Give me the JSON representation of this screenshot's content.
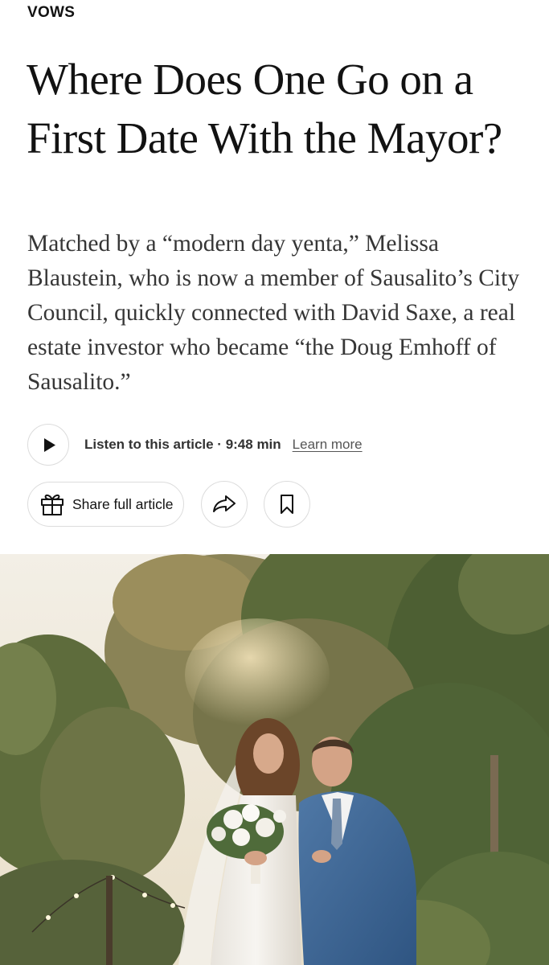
{
  "article": {
    "kicker": "VOWS",
    "headline": "Where Does One Go on a First Date With the Mayor?",
    "summary": "Matched by a “modern day yenta,” Melissa Blaustein, who is now a member of Sausalito’s City Council, quickly connected with David Saxe, a real estate investor who became “the Doug Emhoff of Sausalito.”"
  },
  "audio": {
    "listen_label": "Listen to this article · 9:48 min",
    "learn_more": "Learn more",
    "play_icon": "play-icon"
  },
  "actions": {
    "share_label": "Share full article",
    "gift_icon": "gift-icon",
    "forward_icon": "share-arrow-icon",
    "bookmark_icon": "bookmark-icon"
  },
  "colors": {
    "text": "#121212",
    "summary_text": "#363636",
    "button_border": "#dcdcdc"
  }
}
